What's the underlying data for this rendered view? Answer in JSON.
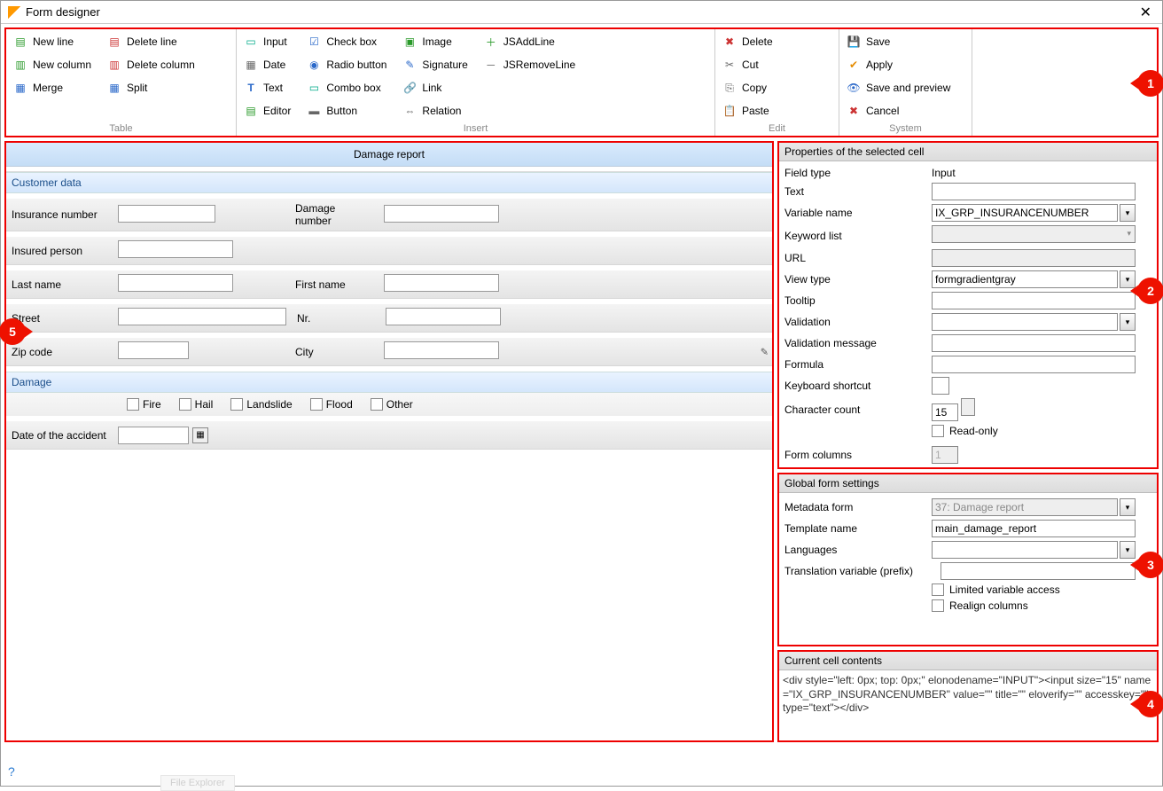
{
  "window": {
    "title": "Form designer"
  },
  "ribbon": {
    "groups": {
      "table": {
        "label": "Table",
        "items": {
          "new_line": "New line",
          "new_column": "New column",
          "merge": "Merge",
          "delete_line": "Delete line",
          "delete_column": "Delete column",
          "split": "Split"
        }
      },
      "insert": {
        "label": "Insert",
        "items": {
          "input": "Input",
          "date": "Date",
          "text": "Text",
          "editor": "Editor",
          "checkbox": "Check box",
          "radio": "Radio button",
          "combo": "Combo box",
          "button": "Button",
          "image": "Image",
          "signature": "Signature",
          "link": "Link",
          "relation": "Relation",
          "jsadd": "JSAddLine",
          "jsremove": "JSRemoveLine"
        }
      },
      "edit": {
        "label": "Edit",
        "items": {
          "delete": "Delete",
          "cut": "Cut",
          "copy": "Copy",
          "paste": "Paste"
        }
      },
      "system": {
        "label": "System",
        "items": {
          "save": "Save",
          "apply": "Apply",
          "save_preview": "Save and preview",
          "cancel": "Cancel"
        }
      }
    }
  },
  "preview": {
    "title": "Damage report",
    "sections": {
      "customer": "Customer data",
      "damage": "Damage"
    },
    "labels": {
      "insurance_number": "Insurance number",
      "damage_number": "Damage number",
      "insured_person": "Insured person",
      "last_name": "Last name",
      "first_name": "First name",
      "street": "Street",
      "nr": "Nr.",
      "zip": "Zip code",
      "city": "City",
      "date_accident": "Date of the accident"
    },
    "damage_types": {
      "fire": "Fire",
      "hail": "Hail",
      "landslide": "Landslide",
      "flood": "Flood",
      "other": "Other"
    }
  },
  "properties": {
    "title": "Properties of the selected cell",
    "rows": {
      "field_type": {
        "label": "Field type",
        "value": "Input"
      },
      "text": {
        "label": "Text",
        "value": ""
      },
      "variable_name": {
        "label": "Variable name",
        "value": "IX_GRP_INSURANCENUMBER"
      },
      "keyword_list": {
        "label": "Keyword list",
        "value": ""
      },
      "url": {
        "label": "URL",
        "value": ""
      },
      "view_type": {
        "label": "View type",
        "value": "formgradientgray"
      },
      "tooltip": {
        "label": "Tooltip",
        "value": ""
      },
      "validation": {
        "label": "Validation",
        "value": ""
      },
      "validation_msg": {
        "label": "Validation message",
        "value": ""
      },
      "formula": {
        "label": "Formula",
        "value": ""
      },
      "kb_shortcut": {
        "label": "Keyboard shortcut",
        "value": ""
      },
      "char_count": {
        "label": "Character count",
        "value": "15"
      },
      "readonly": {
        "label": "Read-only"
      },
      "form_columns": {
        "label": "Form columns",
        "value": "1"
      }
    }
  },
  "global": {
    "title": "Global form settings",
    "rows": {
      "metadata": {
        "label": "Metadata form",
        "value": "37: Damage report"
      },
      "template": {
        "label": "Template name",
        "value": "main_damage_report"
      },
      "languages": {
        "label": "Languages",
        "value": ""
      },
      "trans_prefix": {
        "label": "Translation variable (prefix)",
        "value": ""
      },
      "limited": {
        "label": "Limited variable access"
      },
      "realign": {
        "label": "Realign columns"
      }
    }
  },
  "cellcontents": {
    "title": "Current cell contents",
    "code": "<div style=\"left: 0px; top: 0px;\" elonodename=\"INPUT\"><input size=\"15\" name=\"IX_GRP_INSURANCENUMBER\" value=\"\" title=\"\" eloverify=\"\" accesskey=\"\" type=\"text\"></div>"
  },
  "callouts": {
    "c1": "1",
    "c2": "2",
    "c3": "3",
    "c4": "4",
    "c5": "5"
  },
  "footer": {
    "help": "?",
    "faded": "File Explorer"
  }
}
